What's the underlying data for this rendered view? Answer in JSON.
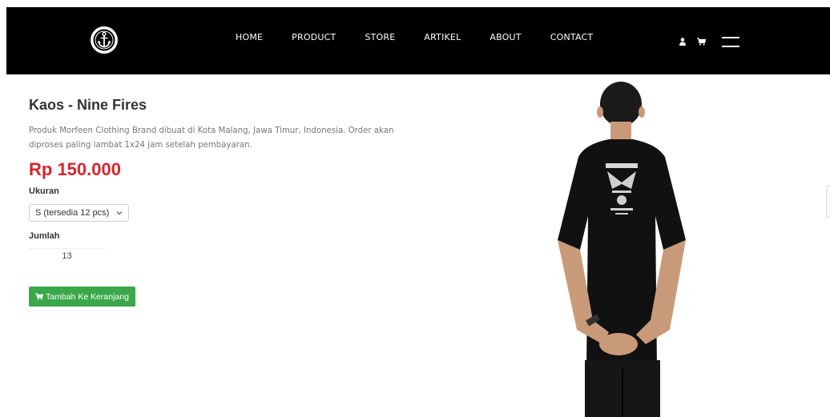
{
  "header": {
    "nav": [
      "HOME",
      "PRODUCT",
      "STORE",
      "ARTIKEL",
      "ABOUT",
      "CONTACT"
    ],
    "icons": [
      "anchor-logo-icon",
      "user-icon",
      "cart-icon",
      "menu-icon"
    ]
  },
  "product": {
    "title": "Kaos - Nine Fires",
    "description": "Produk Morfeen Clothing Brand dibuat di Kota Malang, Jawa Timur, Indonesia. Order akan diproses paling lambat 1x24 jam setelah pembayaran.",
    "price": "Rp 150.000",
    "size_label": "Ukuran",
    "size_selected": "S (tersedia 12 pcs)",
    "qty_label": "Jumlah",
    "qty_value": "13",
    "add_to_cart_label": "Tambah Ke Keranjang"
  },
  "colors": {
    "navbar": "#000000",
    "price": "#d9232d",
    "button": "#3aa84a"
  }
}
